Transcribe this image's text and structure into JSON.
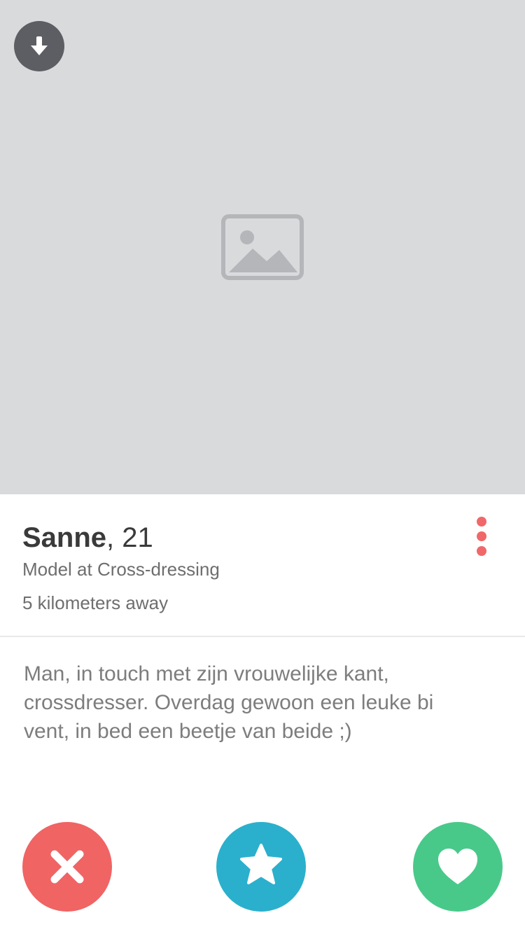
{
  "profile": {
    "name": "Sanne",
    "age_text": ", 21",
    "job": "Model at Cross-dressing",
    "distance": "5 kilometers away",
    "bio": "Man, in touch met zijn vrouwelijke kant,\ncrossdresser. Overdag gewoon een leuke bi\nvent, in bed een beetje van beide ;)"
  },
  "icons": {
    "download": "arrow-down-icon",
    "more": "more-vertical-icon",
    "nope": "close-icon",
    "superlike": "star-icon",
    "like": "heart-icon"
  },
  "colors": {
    "nope": "#f06464",
    "superlike": "#2ab0cc",
    "like": "#48c98a",
    "more_dots": "#f0686a"
  }
}
